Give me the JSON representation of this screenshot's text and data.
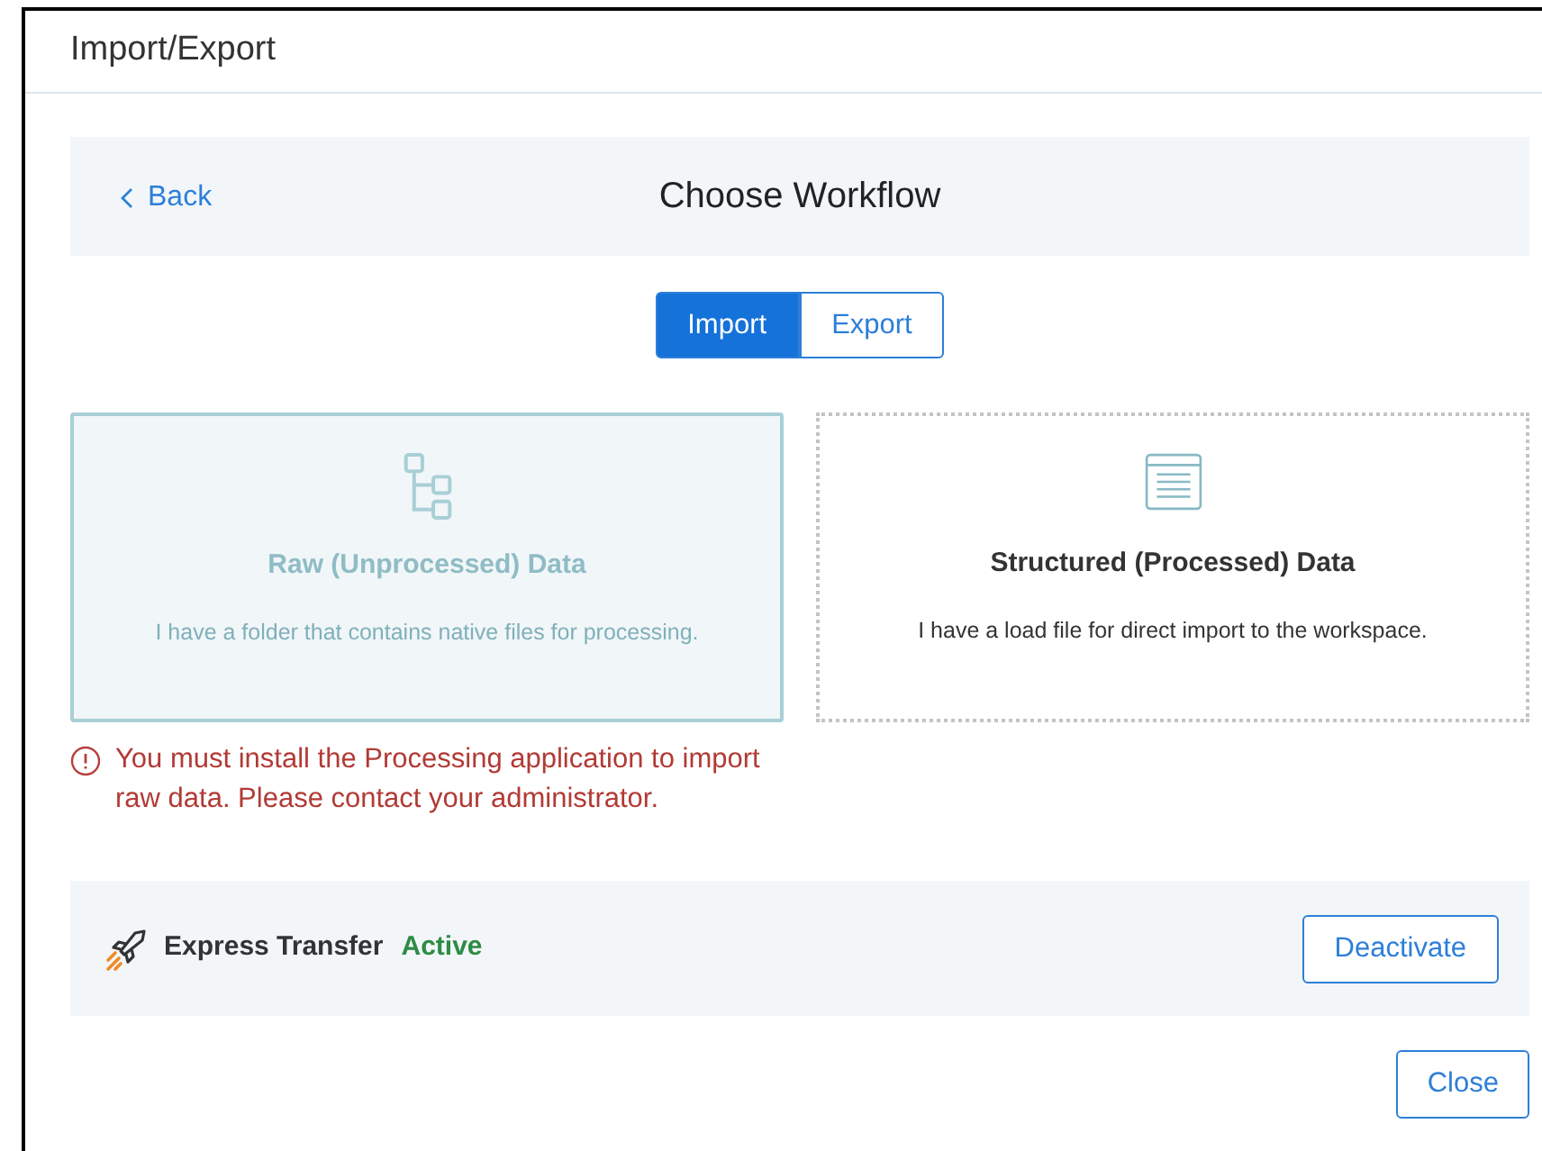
{
  "window": {
    "title": "Import/Export"
  },
  "header": {
    "back": "Back",
    "title": "Choose Workflow"
  },
  "tabs": [
    {
      "label": "Import",
      "selected": true
    },
    {
      "label": "Export",
      "selected": false
    }
  ],
  "cards": [
    {
      "title": "Raw (Unprocessed) Data",
      "description": "I have a folder that contains native files for processing.",
      "disabled": true
    },
    {
      "title": "Structured (Processed) Data",
      "description": "I have a load file for direct import to the workspace.",
      "disabled": false
    }
  ],
  "error": "You must install the Processing application to import raw data. Please contact your administrator.",
  "express_transfer": {
    "label": "Express Transfer",
    "status": "Active",
    "button": "Deactivate"
  },
  "buttons": [
    "Close"
  ]
}
